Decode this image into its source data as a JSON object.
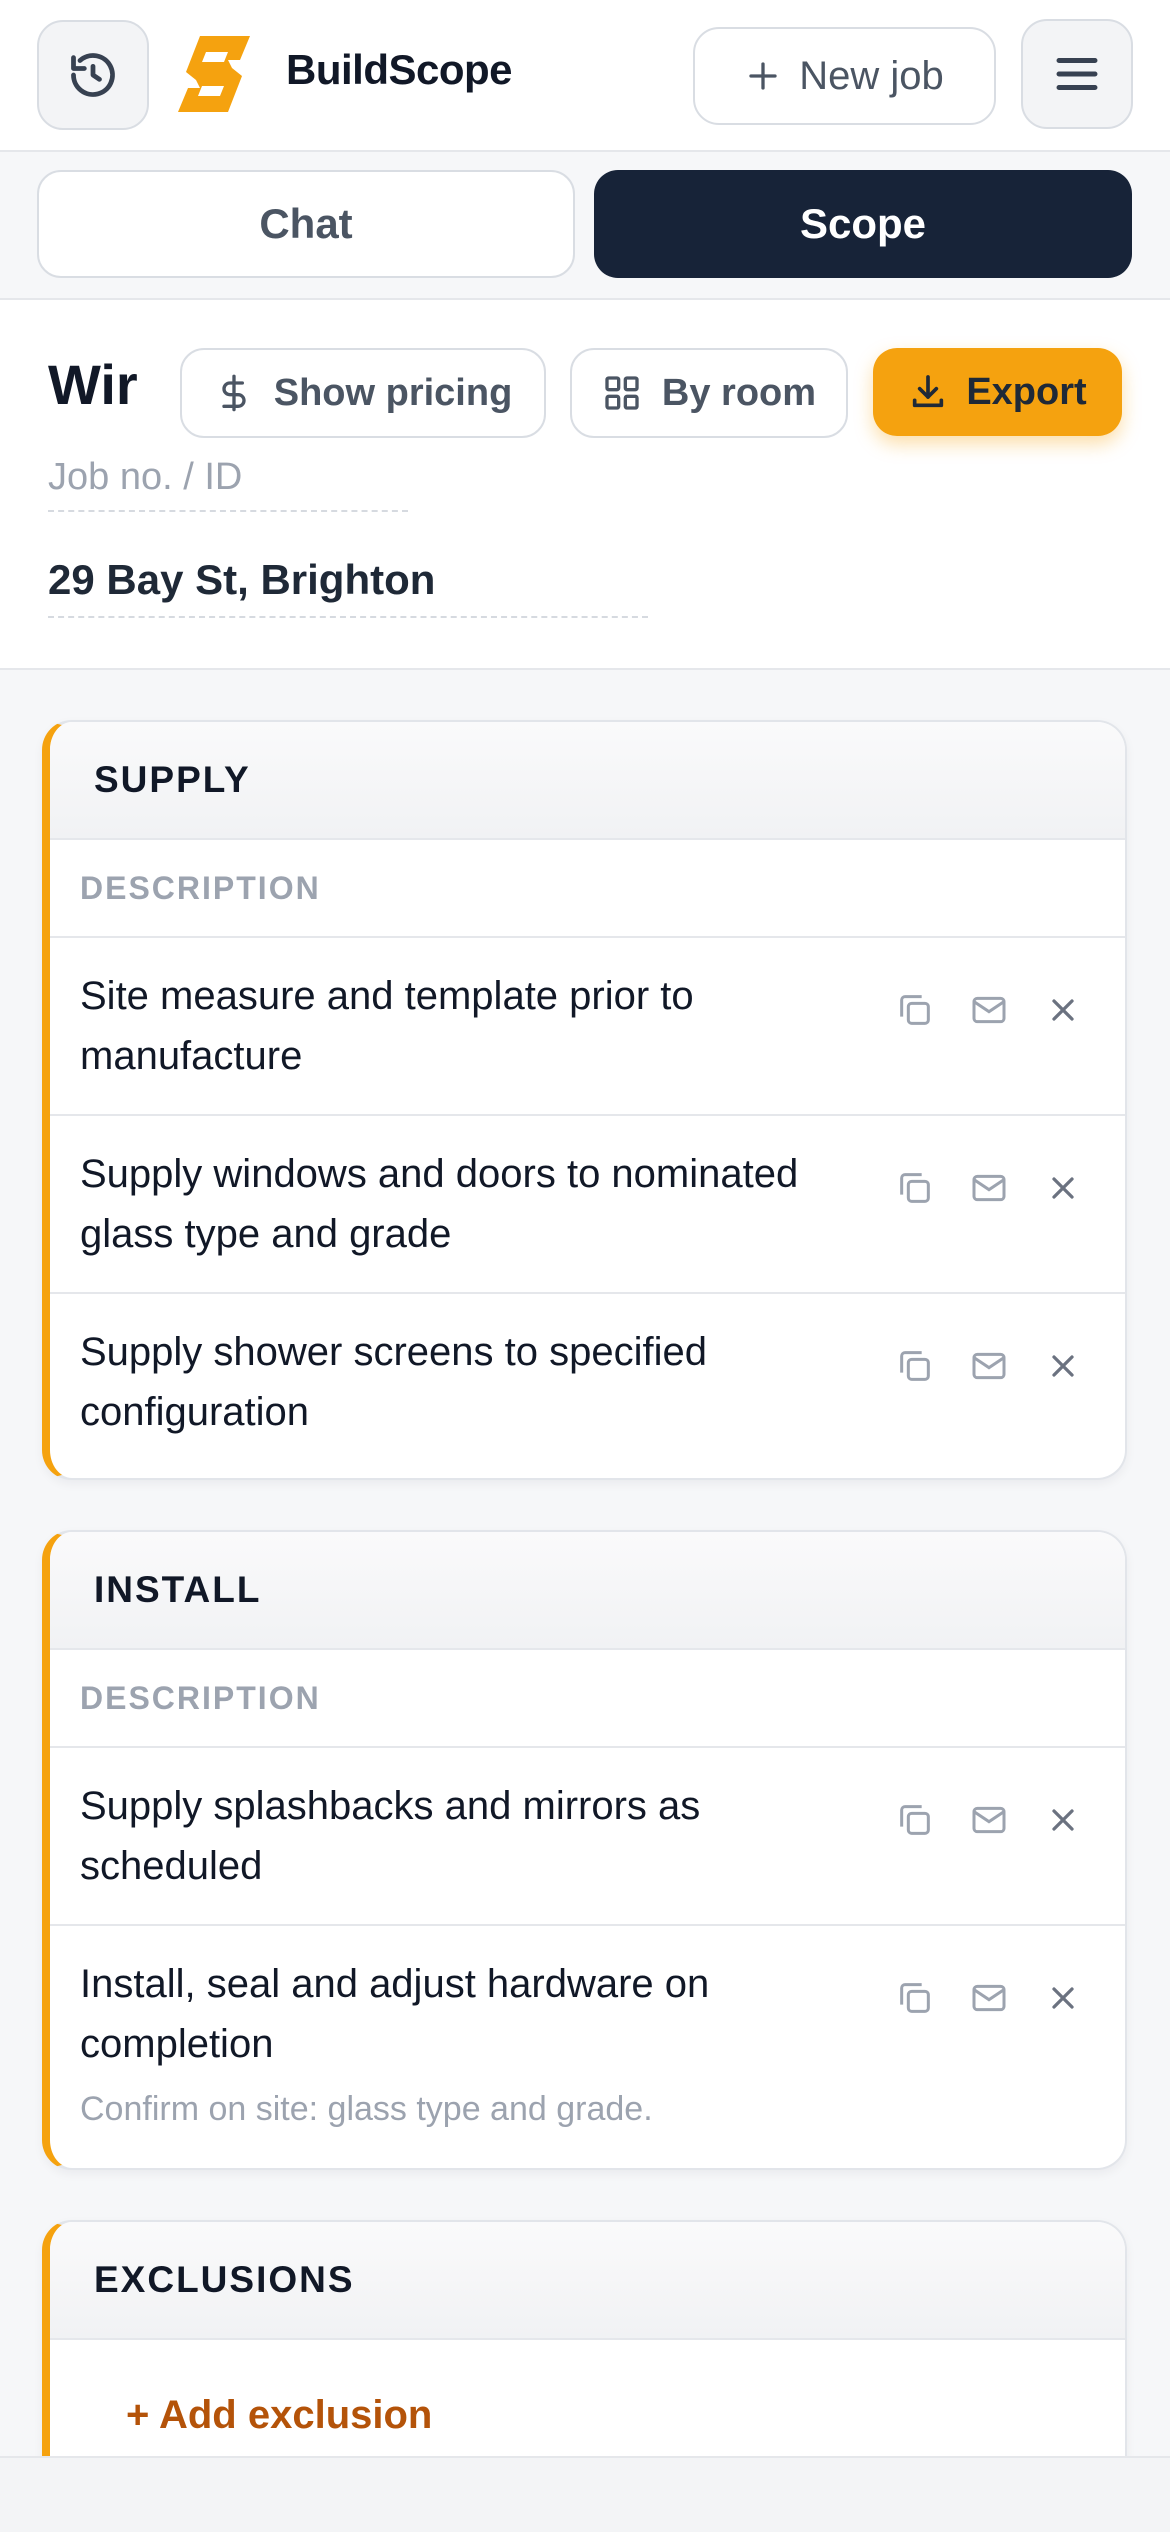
{
  "header": {
    "brand": "BuildScope",
    "new_job_label": "New job",
    "history_icon": "history-icon",
    "menu_icon": "menu-icon",
    "accent_color": "#f5a20f"
  },
  "tabs": {
    "chat_label": "Chat",
    "scope_label": "Scope",
    "active": "Scope"
  },
  "job": {
    "title_truncated": "Wir",
    "show_pricing_label": "Show pricing",
    "by_room_label": "By room",
    "export_label": "Export",
    "job_no_placeholder": "Job no. / ID",
    "address": "29 Bay St, Brighton"
  },
  "sections": {
    "supply": {
      "title": "SUPPLY",
      "column": "DESCRIPTION",
      "rows": [
        {
          "text": "Site measure and template prior to manufacture"
        },
        {
          "text": "Supply windows and doors to nominated glass type and grade"
        },
        {
          "text": "Supply shower screens to specified configuration"
        }
      ]
    },
    "install": {
      "title": "INSTALL",
      "column": "DESCRIPTION",
      "rows": [
        {
          "text": "Supply splashbacks and mirrors as scheduled"
        },
        {
          "text": "Install, seal and adjust hardware on completion",
          "note": "Confirm on site: glass type and grade."
        }
      ]
    },
    "exclusions": {
      "title": "EXCLUSIONS",
      "add_label": "+ Add exclusion"
    }
  }
}
